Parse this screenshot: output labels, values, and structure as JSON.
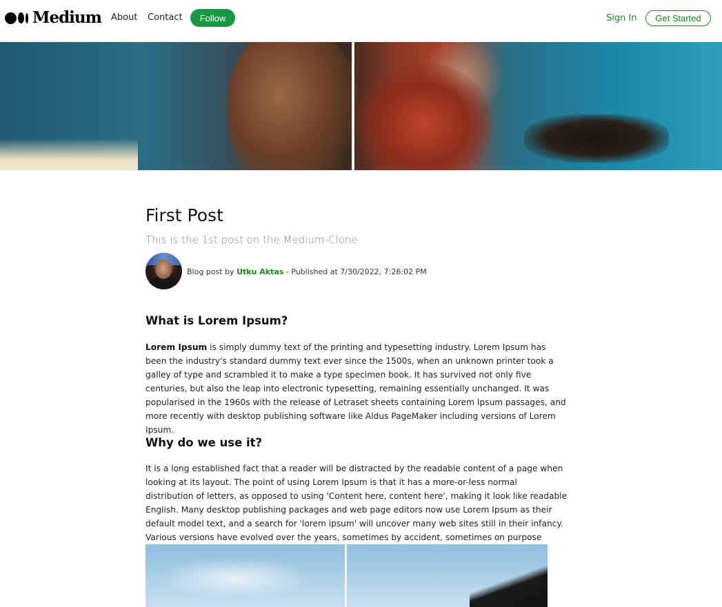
{
  "header": {
    "logo_text": "Medium",
    "nav": {
      "about": "About",
      "contact": "Contact",
      "follow": "Follow"
    },
    "sign_in": "Sign In",
    "get_started": "Get Started"
  },
  "post": {
    "title": "First Post",
    "subtitle": "This is the 1st post on the Medium-Clone",
    "byline_prefix": "Blog post by ",
    "author": "Utku Aktas",
    "byline_suffix": " - Published at 7/30/2022, 7:26:02 PM"
  },
  "sections": [
    {
      "heading": "What is Lorem Ipsum?",
      "lead_bold": "Lorem Ipsum",
      "body": " is simply dummy text of the printing and typesetting industry. Lorem Ipsum has been the industry's standard dummy text ever since the 1500s, when an unknown printer took a galley of type and scrambled it to make a type specimen book. It has survived not only five centuries, but also the leap into electronic typesetting, remaining essentially unchanged. It was popularised in the 1960s with the release of Letraset sheets containing Lorem Ipsum passages, and more recently with desktop publishing software like Aldus PageMaker including versions of Lorem Ipsum."
    },
    {
      "heading": "Why do we use it?",
      "body": "It is a long established fact that a reader will be distracted by the readable content of a page when looking at its layout. The point of using Lorem Ipsum is that it has a more-or-less normal distribution of letters, as opposed to using 'Content here, content here', making it look like readable English. Many desktop publishing packages and web page editors now use Lorem Ipsum as their default model text, and a search for 'lorem ipsum' will uncover many web sites still in their infancy. Various versions have evolved over the years, sometimes by accident, sometimes on purpose (injected humour and the like)."
    }
  ],
  "colors": {
    "brand_green": "#1a8917",
    "follow_button": "#1a9943",
    "text": "#111111",
    "subtitle": "#888888"
  }
}
